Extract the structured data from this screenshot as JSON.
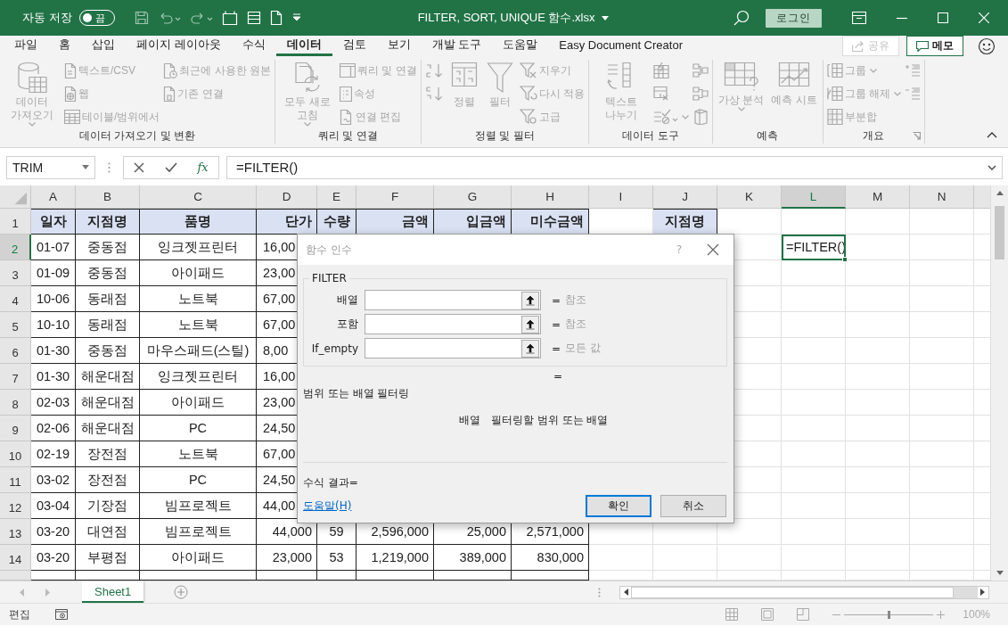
{
  "title_bar": {
    "autosave_label": "자동 저장",
    "autosave_on": false,
    "autosave_state": "끔",
    "file_title": "FILTER, SORT, UNIQUE 함수.xlsx",
    "login_button": "로그인"
  },
  "menu_tabs": [
    {
      "label": "파일",
      "selected": false
    },
    {
      "label": "홈",
      "selected": false
    },
    {
      "label": "삽입",
      "selected": false
    },
    {
      "label": "페이지 레이아웃",
      "selected": false
    },
    {
      "label": "수식",
      "selected": false
    },
    {
      "label": "데이터",
      "selected": true
    },
    {
      "label": "검토",
      "selected": false
    },
    {
      "label": "보기",
      "selected": false
    },
    {
      "label": "개발 도구",
      "selected": false
    },
    {
      "label": "도움말",
      "selected": false
    },
    {
      "label": "Easy Document Creator",
      "selected": false
    }
  ],
  "share_button": {
    "label": "공유",
    "disabled": true
  },
  "comments_button": {
    "label": "메모"
  },
  "ribbon_groups": [
    {
      "label": "데이터 가져오기 및 변환",
      "launcher": false,
      "columns": [
        [
          {
            "kind": "large",
            "label": "데이터 가져오기",
            "dropdown": true,
            "disabled": true
          }
        ],
        [
          {
            "kind": "small",
            "label": "텍스트/CSV",
            "dropdown": false,
            "disabled": true
          },
          {
            "kind": "small",
            "label": "웹",
            "dropdown": false,
            "disabled": true
          },
          {
            "kind": "small",
            "label": "테이블/범위에서",
            "dropdown": false,
            "disabled": true
          }
        ],
        [
          {
            "kind": "small",
            "label": "최근에 사용한 원본",
            "dropdown": false,
            "disabled": true
          },
          {
            "kind": "small",
            "label": "기존 연결",
            "dropdown": false,
            "disabled": true
          }
        ]
      ]
    },
    {
      "label": "쿼리 및 연결",
      "launcher": false,
      "columns": [
        [
          {
            "kind": "large",
            "label": "모두 새로 고침",
            "dropdown": true,
            "disabled": true
          }
        ],
        [
          {
            "kind": "small",
            "label": "쿼리 및 연결",
            "dropdown": false,
            "disabled": true
          },
          {
            "kind": "small",
            "label": "속성",
            "dropdown": false,
            "disabled": true
          },
          {
            "kind": "small",
            "label": "연결 편집",
            "dropdown": false,
            "disabled": true
          }
        ]
      ]
    },
    {
      "label": "정렬 및 필터",
      "launcher": false,
      "columns": [
        [
          {
            "kind": "icon",
            "dropdown": false,
            "disabled": true
          },
          {
            "kind": "icon",
            "dropdown": false,
            "disabled": true
          }
        ],
        [
          {
            "kind": "large",
            "label": "정렬",
            "dropdown": false,
            "disabled": true
          }
        ],
        [
          {
            "kind": "large",
            "label": "필터",
            "dropdown": false,
            "disabled": true
          }
        ],
        [
          {
            "kind": "small",
            "label": "지우기",
            "dropdown": false,
            "disabled": true
          },
          {
            "kind": "small",
            "label": "다시 적용",
            "dropdown": false,
            "disabled": true
          },
          {
            "kind": "small",
            "label": "고급",
            "dropdown": false,
            "disabled": true
          }
        ]
      ]
    },
    {
      "label": "데이터 도구",
      "launcher": false,
      "columns": [
        [
          {
            "kind": "large",
            "label": "텍스트 나누기",
            "dropdown": false,
            "disabled": true
          }
        ],
        [
          {
            "kind": "icon",
            "dropdown": false,
            "disabled": true
          },
          {
            "kind": "icon",
            "dropdown": false,
            "disabled": true
          },
          {
            "kind": "icon",
            "dropdown": true,
            "disabled": true
          }
        ],
        [
          {
            "kind": "icon",
            "dropdown": false,
            "disabled": true
          },
          {
            "kind": "icon",
            "dropdown": false,
            "disabled": true
          },
          {
            "kind": "icon",
            "dropdown": false,
            "disabled": true
          }
        ]
      ]
    },
    {
      "label": "예측",
      "launcher": false,
      "columns": [
        [
          {
            "kind": "large",
            "label": "가상 분석",
            "dropdown": true,
            "disabled": true
          }
        ],
        [
          {
            "kind": "large",
            "label": "예측 시트",
            "dropdown": false,
            "disabled": true
          }
        ]
      ]
    },
    {
      "label": "개요",
      "launcher": true,
      "columns": [
        [
          {
            "kind": "small",
            "label": "그룹",
            "dropdown": true,
            "disabled": true
          },
          {
            "kind": "small",
            "label": "그룹 해제",
            "dropdown": true,
            "disabled": true
          },
          {
            "kind": "small",
            "label": "부분합",
            "dropdown": false,
            "disabled": true
          }
        ],
        [
          {
            "kind": "icon",
            "dropdown": false,
            "disabled": true
          },
          {
            "kind": "icon",
            "dropdown": false,
            "disabled": true
          }
        ]
      ]
    }
  ],
  "formula_bar": {
    "name_box": "TRIM",
    "function_label": "fx",
    "formula": "=FILTER()"
  },
  "columns": [
    {
      "label": "A",
      "selected": false
    },
    {
      "label": "B",
      "selected": false
    },
    {
      "label": "C",
      "selected": false
    },
    {
      "label": "D",
      "selected": false
    },
    {
      "label": "E",
      "selected": false
    },
    {
      "label": "F",
      "selected": false
    },
    {
      "label": "G",
      "selected": false
    },
    {
      "label": "H",
      "selected": false
    },
    {
      "label": "I",
      "selected": false
    },
    {
      "label": "J",
      "selected": false
    },
    {
      "label": "K",
      "selected": false
    },
    {
      "label": "L",
      "selected": true
    },
    {
      "label": "M",
      "selected": false
    },
    {
      "label": "N",
      "selected": false
    }
  ],
  "rows": [
    {
      "number": "1",
      "selected": false,
      "kind": "header",
      "cells": {
        "A": {
          "text": "일자",
          "selected": false
        },
        "B": {
          "text": "지점명",
          "selected": false
        },
        "C": {
          "text": "품명",
          "selected": false
        },
        "D": {
          "text": "단가",
          "selected": false
        },
        "E": {
          "text": "수량",
          "selected": false
        },
        "F": {
          "text": "금액",
          "selected": false
        },
        "G": {
          "text": "입금액",
          "selected": false
        },
        "H": {
          "text": "미수금액",
          "selected": false
        },
        "J": {
          "text": "지점명",
          "selected": false
        }
      }
    },
    {
      "number": "2",
      "selected": true,
      "kind": "data",
      "cells": {
        "A": {
          "text": "01-07",
          "selected": false
        },
        "B": {
          "text": "중동점",
          "selected": false
        },
        "C": {
          "text": "잉크젯프린터",
          "selected": false
        },
        "D": {
          "text": "16,00",
          "selected": false,
          "cut": true
        },
        "L": {
          "text": "=FILTER()",
          "selected": true
        }
      }
    },
    {
      "number": "3",
      "selected": false,
      "kind": "data",
      "cells": {
        "A": {
          "text": "01-09",
          "selected": false
        },
        "B": {
          "text": "중동점",
          "selected": false
        },
        "C": {
          "text": "아이패드",
          "selected": false
        },
        "D": {
          "text": "23,00",
          "selected": false,
          "cut": true
        }
      }
    },
    {
      "number": "4",
      "selected": false,
      "kind": "data",
      "cells": {
        "A": {
          "text": "10-06",
          "selected": false
        },
        "B": {
          "text": "동래점",
          "selected": false
        },
        "C": {
          "text": "노트북",
          "selected": false
        },
        "D": {
          "text": "67,00",
          "selected": false,
          "cut": true
        }
      }
    },
    {
      "number": "5",
      "selected": false,
      "kind": "data",
      "cells": {
        "A": {
          "text": "10-10",
          "selected": false
        },
        "B": {
          "text": "동래점",
          "selected": false
        },
        "C": {
          "text": "노트북",
          "selected": false
        },
        "D": {
          "text": "67,00",
          "selected": false,
          "cut": true
        }
      }
    },
    {
      "number": "6",
      "selected": false,
      "kind": "data",
      "cells": {
        "A": {
          "text": "01-30",
          "selected": false
        },
        "B": {
          "text": "중동점",
          "selected": false
        },
        "C": {
          "text": "마우스패드(스틸)",
          "selected": false
        },
        "D": {
          "text": "8,00",
          "selected": false,
          "cut": true
        }
      }
    },
    {
      "number": "7",
      "selected": false,
      "kind": "data",
      "cells": {
        "A": {
          "text": "01-30",
          "selected": false
        },
        "B": {
          "text": "해운대점",
          "selected": false
        },
        "C": {
          "text": "잉크젯프린터",
          "selected": false
        },
        "D": {
          "text": "16,00",
          "selected": false,
          "cut": true
        }
      }
    },
    {
      "number": "8",
      "selected": false,
      "kind": "data",
      "cells": {
        "A": {
          "text": "02-03",
          "selected": false
        },
        "B": {
          "text": "해운대점",
          "selected": false
        },
        "C": {
          "text": "아이패드",
          "selected": false
        },
        "D": {
          "text": "23,00",
          "selected": false,
          "cut": true
        }
      }
    },
    {
      "number": "9",
      "selected": false,
      "kind": "data",
      "cells": {
        "A": {
          "text": "02-06",
          "selected": false
        },
        "B": {
          "text": "해운대점",
          "selected": false
        },
        "C": {
          "text": "PC",
          "selected": false
        },
        "D": {
          "text": "24,50",
          "selected": false,
          "cut": true
        }
      }
    },
    {
      "number": "10",
      "selected": false,
      "kind": "data",
      "cells": {
        "A": {
          "text": "02-19",
          "selected": false
        },
        "B": {
          "text": "장전점",
          "selected": false
        },
        "C": {
          "text": "노트북",
          "selected": false
        },
        "D": {
          "text": "67,00",
          "selected": false,
          "cut": true
        }
      }
    },
    {
      "number": "11",
      "selected": false,
      "kind": "data",
      "cells": {
        "A": {
          "text": "03-02",
          "selected": false
        },
        "B": {
          "text": "장전점",
          "selected": false
        },
        "C": {
          "text": "PC",
          "selected": false
        },
        "D": {
          "text": "24,50",
          "selected": false,
          "cut": true
        }
      }
    },
    {
      "number": "12",
      "selected": false,
      "kind": "data",
      "cells": {
        "A": {
          "text": "03-04",
          "selected": false
        },
        "B": {
          "text": "기장점",
          "selected": false
        },
        "C": {
          "text": "빔프로젝트",
          "selected": false
        },
        "D": {
          "text": "44,00",
          "selected": false,
          "cut": true
        }
      }
    },
    {
      "number": "13",
      "selected": false,
      "kind": "data",
      "cells": {
        "A": {
          "text": "03-20",
          "selected": false
        },
        "B": {
          "text": "대연점",
          "selected": false
        },
        "C": {
          "text": "빔프로젝트",
          "selected": false
        },
        "D": {
          "text": "44,000",
          "selected": false
        },
        "E": {
          "text": "59",
          "selected": false
        },
        "F": {
          "text": "2,596,000",
          "selected": false
        },
        "G": {
          "text": "25,000",
          "selected": false
        },
        "H": {
          "text": "2,571,000",
          "selected": false
        }
      }
    },
    {
      "number": "14",
      "selected": false,
      "kind": "data",
      "cells": {
        "A": {
          "text": "03-20",
          "selected": false
        },
        "B": {
          "text": "부평점",
          "selected": false
        },
        "C": {
          "text": "아이패드",
          "selected": false
        },
        "D": {
          "text": "23,000",
          "selected": false
        },
        "E": {
          "text": "53",
          "selected": false
        },
        "F": {
          "text": "1,219,000",
          "selected": false
        },
        "G": {
          "text": "389,000",
          "selected": false
        },
        "H": {
          "text": "830,000",
          "selected": false
        }
      }
    }
  ],
  "dialog": {
    "title": "함수 인수",
    "help_glyph": "?",
    "function_name": "FILTER",
    "arguments": [
      {
        "label": "배열",
        "equals": "=",
        "hint": "참조"
      },
      {
        "label": "포함",
        "equals": "=",
        "hint": "참조"
      },
      {
        "label": "If_empty",
        "equals": "=",
        "hint": "모든 값"
      }
    ],
    "result_equals": "=",
    "description": "범위 또는 배열 필터링",
    "argument_name": "배열",
    "argument_description": "필터링할 범위 또는 배열",
    "formula_result": "수식 결과=",
    "help_link": "도움말(H)",
    "buttons": [
      {
        "label": "확인",
        "default": true
      },
      {
        "label": "취소",
        "default": false
      }
    ]
  },
  "sheet_tabs": [
    {
      "label": "Sheet1",
      "selected": true
    }
  ],
  "status_bar": {
    "mode": "편집",
    "zoom_level": "100%",
    "zoom": {
      "level": 0.5
    }
  }
}
